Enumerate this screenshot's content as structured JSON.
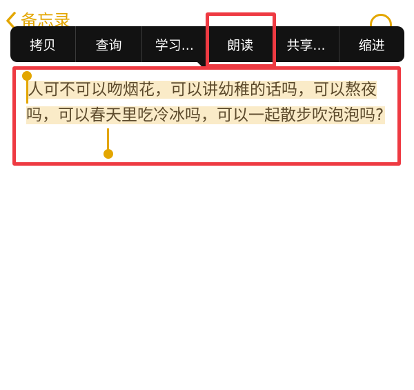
{
  "nav": {
    "back_label": "备忘录"
  },
  "context_menu": {
    "items": [
      {
        "label": "拷贝"
      },
      {
        "label": "查询"
      },
      {
        "label": "学习..."
      },
      {
        "label": "朗读"
      },
      {
        "label": "共享..."
      },
      {
        "label": "缩进"
      }
    ]
  },
  "note": {
    "text": "人可不可以吻烟花，可以讲幼稚的话吗，可以熬夜吗，可以春天里吃冷冰吗，可以一起散步吹泡泡吗?"
  },
  "colors": {
    "accent": "#e3a600",
    "selection_highlight": "#faebc8",
    "menu_background": "#121212",
    "annotation": "#ee3a42"
  }
}
